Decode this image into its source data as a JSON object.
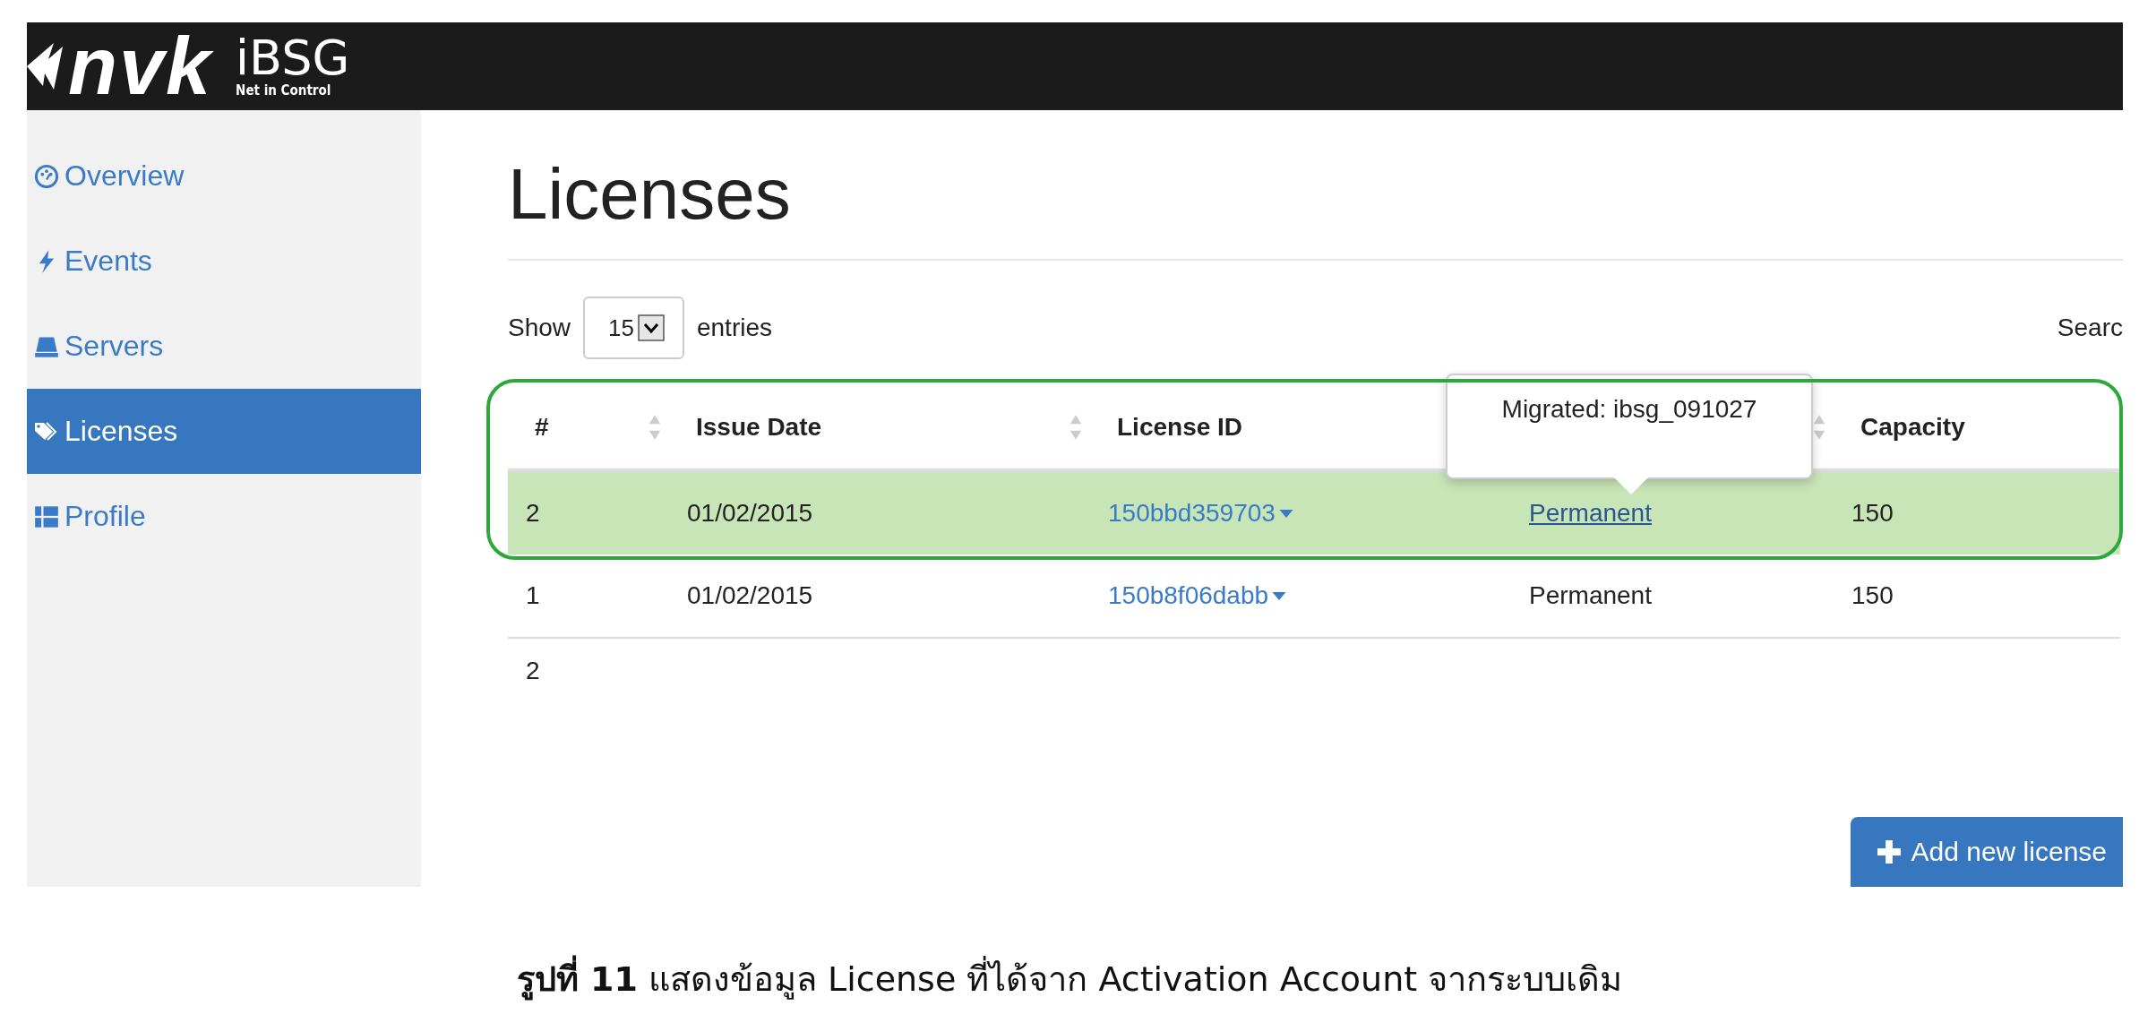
{
  "header": {
    "logo_text": "nvk",
    "product": "iBSG",
    "tagline": "Net in Control"
  },
  "sidebar": {
    "items": [
      {
        "label": "Overview",
        "selected": false
      },
      {
        "label": "Events",
        "selected": false
      },
      {
        "label": "Servers",
        "selected": false
      },
      {
        "label": "Licenses",
        "selected": true
      },
      {
        "label": "Profile",
        "selected": false
      }
    ]
  },
  "page": {
    "title": "Licenses",
    "show_label": "Show",
    "page_size": "15",
    "entries_label": "entries",
    "search_label": "Searc"
  },
  "table": {
    "columns": [
      {
        "label": "#",
        "sortable": true
      },
      {
        "label": "Issue Date",
        "sortable": true
      },
      {
        "label": "License ID",
        "sortable": false
      },
      {
        "sortable": true
      },
      {
        "label": "Capacity",
        "sortable": false
      }
    ],
    "rows": [
      {
        "cells": [
          "2",
          "01/02/2015",
          "150bbd359703",
          "Permanent",
          "150"
        ],
        "selected": true,
        "status_link": true
      },
      {
        "cells": [
          "1",
          "01/02/2015",
          "150b8f06dabb",
          "Permanent",
          "150"
        ],
        "selected": false,
        "status_link": false
      }
    ],
    "footer": "2"
  },
  "tooltip": {
    "text": "Migrated: ibsg_091027"
  },
  "add_button": {
    "label": "Add new license"
  },
  "caption": "**รูปที่ 11** แสดงข้อมูล License ที่ได้จาก Activation Account จากระบบเดิม"
}
